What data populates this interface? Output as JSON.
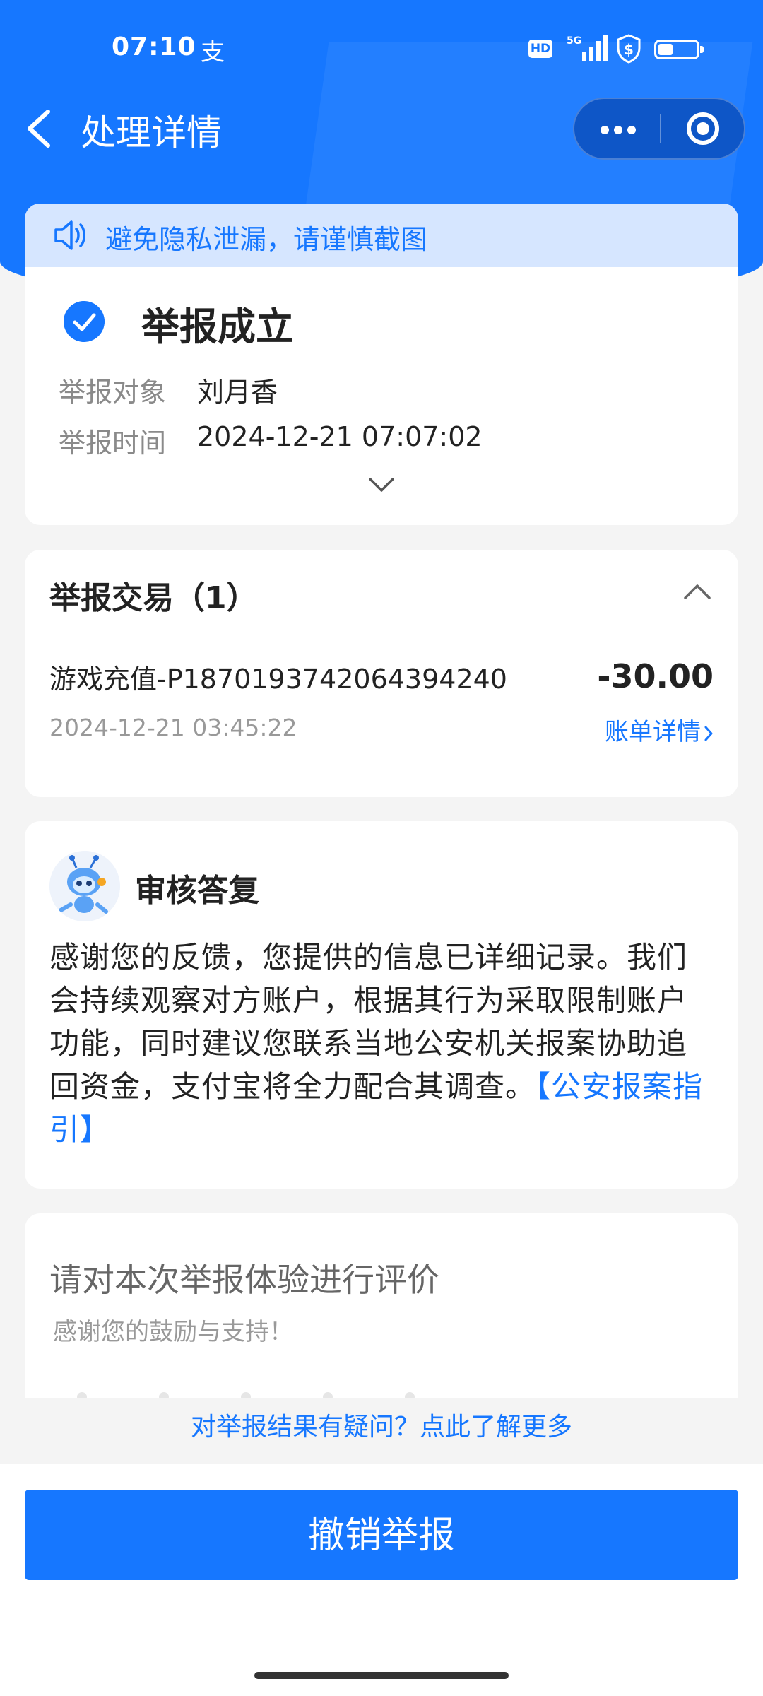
{
  "status_bar": {
    "time": "07:10",
    "app_glyph": "支",
    "hd": "HD",
    "network": "5G",
    "battery_icon": "battery-icon"
  },
  "nav": {
    "title": "处理详情",
    "back_icon": "back-icon",
    "more_icon": "more-icon",
    "close_icon": "mini-program-close-icon"
  },
  "notice": {
    "text": "避免隐私泄漏，请谨慎截图",
    "icon": "speaker-icon"
  },
  "report": {
    "status": "举报成立",
    "target_label": "举报对象",
    "target_value": "刘月香",
    "time_label": "举报时间",
    "time_value": "2024-12-21 07:07:02"
  },
  "transactions": {
    "title": "举报交易（1）",
    "items": [
      {
        "name": "游戏充值-P1870193742064394240",
        "amount": "-30.00",
        "time": "2024-12-21 03:45:22",
        "link": "账单详情"
      }
    ]
  },
  "reply": {
    "title": "审核答复",
    "text": "感谢您的反馈，您提供的信息已详细记录。我们会持续观察对方账户，根据其行为采取限制账户功能，同时建议您联系当地公安机关报案协助追回资金，支付宝将全力配合其调查。",
    "link": "【公安报案指引】"
  },
  "rating": {
    "title": "请对本次举报体验进行评价",
    "subtitle": "感谢您的鼓励与支持！"
  },
  "footer": {
    "faq_link": "对举报结果有疑问？点此了解更多",
    "cancel_button": "撤销举报"
  },
  "colors": {
    "primary": "#1677ff",
    "notice_bg": "#d6e6ff",
    "page_bg": "#f4f4f4"
  }
}
